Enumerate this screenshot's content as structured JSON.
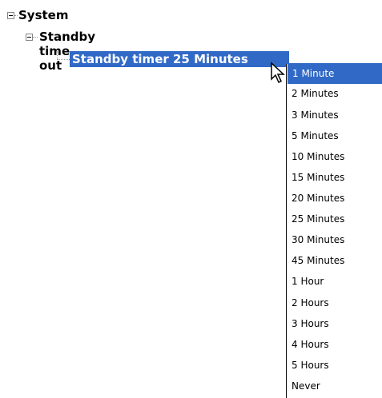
{
  "tree": {
    "root": {
      "label": "System"
    },
    "child": {
      "label": "Standby time out"
    },
    "leaf": {
      "label": "Standby timer 25 Minutes"
    }
  },
  "dropdown": {
    "selected_index": 0,
    "options": [
      "1 Minute",
      "2 Minutes",
      "3 Minutes",
      "5 Minutes",
      "10 Minutes",
      "15 Minutes",
      "20 Minutes",
      "25 Minutes",
      "30 Minutes",
      "45 Minutes",
      "1 Hour",
      "2 Hours",
      "3 Hours",
      "4 Hours",
      "5 Hours",
      "Never"
    ]
  },
  "colors": {
    "highlight": "#3169c6",
    "highlight_text": "#ffffff",
    "tree_lines": "#9a9a9a"
  },
  "icons": {
    "expander": "minus-box",
    "cursor": "arrow-pointer"
  }
}
